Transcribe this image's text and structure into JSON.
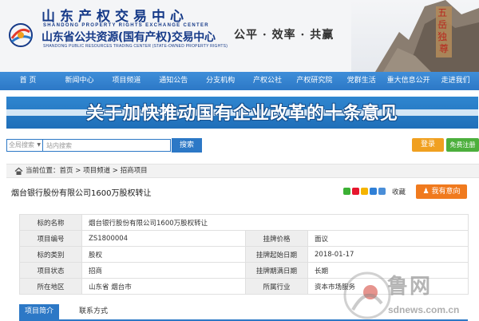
{
  "header": {
    "logo_cn": "山东产权交易中心",
    "logo_en": "SHANDONG PROPERTY RIGHTS EXCHANGE CENTER",
    "logo_sub_cn": "山东省公共资源(国有产权)交易中心",
    "logo_sub_en": "SHANDONG PUBLIC RESOURCES TRADING CENTER (STATE-OWNED PROPERTY RIGHTS)",
    "slogan": "公平 · 效率 · 共赢",
    "mountain_inscription": "五岳独尊",
    "brand_color": "#163a88"
  },
  "nav": {
    "items": [
      {
        "label": "首 页"
      },
      {
        "label": "新闻中心"
      },
      {
        "label": "项目频道"
      },
      {
        "label": "通知公告"
      },
      {
        "label": "分支机构"
      },
      {
        "label": "产权公社"
      },
      {
        "label": "产权研究院"
      },
      {
        "label": "党群生活"
      },
      {
        "label": "重大信息公开"
      },
      {
        "label": "走进我们"
      }
    ],
    "color": "#2c78c6"
  },
  "banner": {
    "title": "关于加快推动国有企业改革的十条意见"
  },
  "search": {
    "scope": "全局搜索",
    "placeholder": "站内搜索",
    "button": "搜索"
  },
  "account": {
    "login": "登录",
    "register": "免费注册"
  },
  "breadcrumb": {
    "prefix": "当前位置：",
    "items": [
      "首页",
      "项目频道",
      "招商项目"
    ],
    "separator": " > "
  },
  "project": {
    "title": "烟台银行股份有限公司1600万股权转让",
    "collect": "收藏",
    "intent_button": "我有意向",
    "share_icons": [
      "wechat-icon",
      "weibo-icon",
      "qzone-icon",
      "renren-icon",
      "tencent-icon"
    ]
  },
  "info": {
    "name_label": "标的名称",
    "name_value": "烟台银行股份有限公司1600万股权转让",
    "rows": [
      {
        "l1": "项目编号",
        "v1": "ZS1800004",
        "l2": "挂牌价格",
        "v2": "面议"
      },
      {
        "l1": "标的类别",
        "v1": "股权",
        "l2": "挂牌起始日期",
        "v2": "2018-01-17"
      },
      {
        "l1": "项目状态",
        "v1": "招商",
        "l2": "挂牌期满日期",
        "v2": "长期"
      },
      {
        "l1": "所在地区",
        "v1": "山东省 烟台市",
        "l2": "所属行业",
        "v2": "资本市场服务"
      }
    ]
  },
  "tabs": {
    "items": [
      {
        "label": "项目简介",
        "active": true
      },
      {
        "label": "联系方式",
        "active": false
      }
    ]
  },
  "watermark": {
    "text": "鲁网",
    "url": "sdnews.com.cn"
  }
}
